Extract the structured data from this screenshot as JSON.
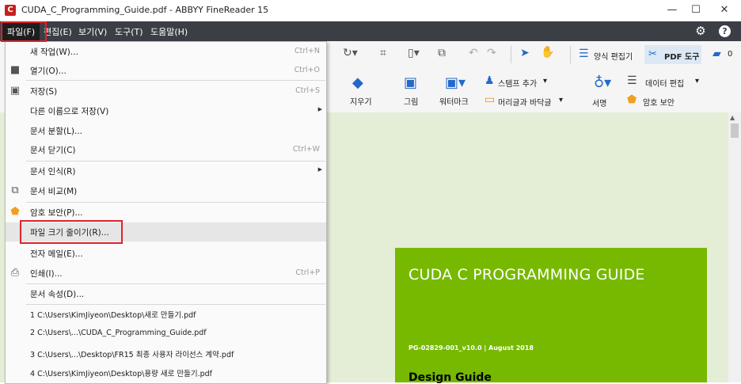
{
  "window": {
    "title": "CUDA_C_Programming_Guide.pdf - ABBYY FineReader 15",
    "icon_name": "abbyy-app-icon",
    "minimize": "—",
    "maximize": "☐",
    "close": "✕"
  },
  "menubar": {
    "items": [
      "파일(F)",
      "편집(E)",
      "보기(V)",
      "도구(T)",
      "도움말(H)"
    ],
    "right_icons": [
      "gear-icon",
      "help-icon"
    ]
  },
  "toolbar": {
    "form_editor": "양식 편집기",
    "pdf_tools": "PDF 도구",
    "comments_count": "0",
    "add_stamp": "스탬프 추가",
    "edit_data": "데이터 편집",
    "erase": "지우기",
    "picture": "그림",
    "watermark": "워터마크",
    "header_footer": "머리글과 바닥글",
    "signature": "서명",
    "password_protect": "암호 보안"
  },
  "file_menu": {
    "items": [
      {
        "label": "새 작업(W)...",
        "shortcut": "Ctrl+N",
        "icon": ""
      },
      {
        "label": "열기(O)...",
        "shortcut": "Ctrl+O",
        "icon": "folder-icon"
      },
      {
        "label": "저장(S)",
        "shortcut": "Ctrl+S",
        "icon": "save-icon"
      },
      {
        "label": "다른 이름으로 저장(V)",
        "shortcut": "",
        "icon": "",
        "submenu": true
      },
      {
        "label": "문서 분할(L)...",
        "shortcut": "",
        "icon": ""
      },
      {
        "label": "문서 닫기(C)",
        "shortcut": "Ctrl+W",
        "icon": ""
      },
      {
        "label": "문서 인식(R)",
        "shortcut": "",
        "icon": "",
        "submenu": true
      },
      {
        "label": "문서 비교(M)",
        "shortcut": "",
        "icon": "compare-icon"
      },
      {
        "label": "암호 보안(P)...",
        "shortcut": "",
        "icon": "shield-icon"
      },
      {
        "label": "파일 크기 줄이기(R)...",
        "shortcut": "",
        "icon": "",
        "highlighted": true
      },
      {
        "label": "전자 메일(E)...",
        "shortcut": "",
        "icon": ""
      },
      {
        "label": "인쇄(I)...",
        "shortcut": "Ctrl+P",
        "icon": "printer-icon"
      },
      {
        "label": "문서 속성(D)...",
        "shortcut": "",
        "icon": ""
      }
    ],
    "recent": [
      "1 C:\\Users\\KimJiyeon\\Desktop\\새로 만들기.pdf",
      "2 C:\\Users\\...\\CUDA_C_Programming_Guide.pdf",
      "3 C:\\Users\\...\\Desktop\\FR15 최종 사용자 라이선스 계약.pdf",
      "4 C:\\Users\\KimJiyeon\\Desktop\\용량 새로 만들기.pdf"
    ]
  },
  "document": {
    "title": "CUDA C PROGRAMMING GUIDE",
    "subtitle": "PG-02829-001_v10.0 | August 2018",
    "section": "Design Guide",
    "cover_color": "#76b900",
    "background_color": "#e4eed6"
  }
}
